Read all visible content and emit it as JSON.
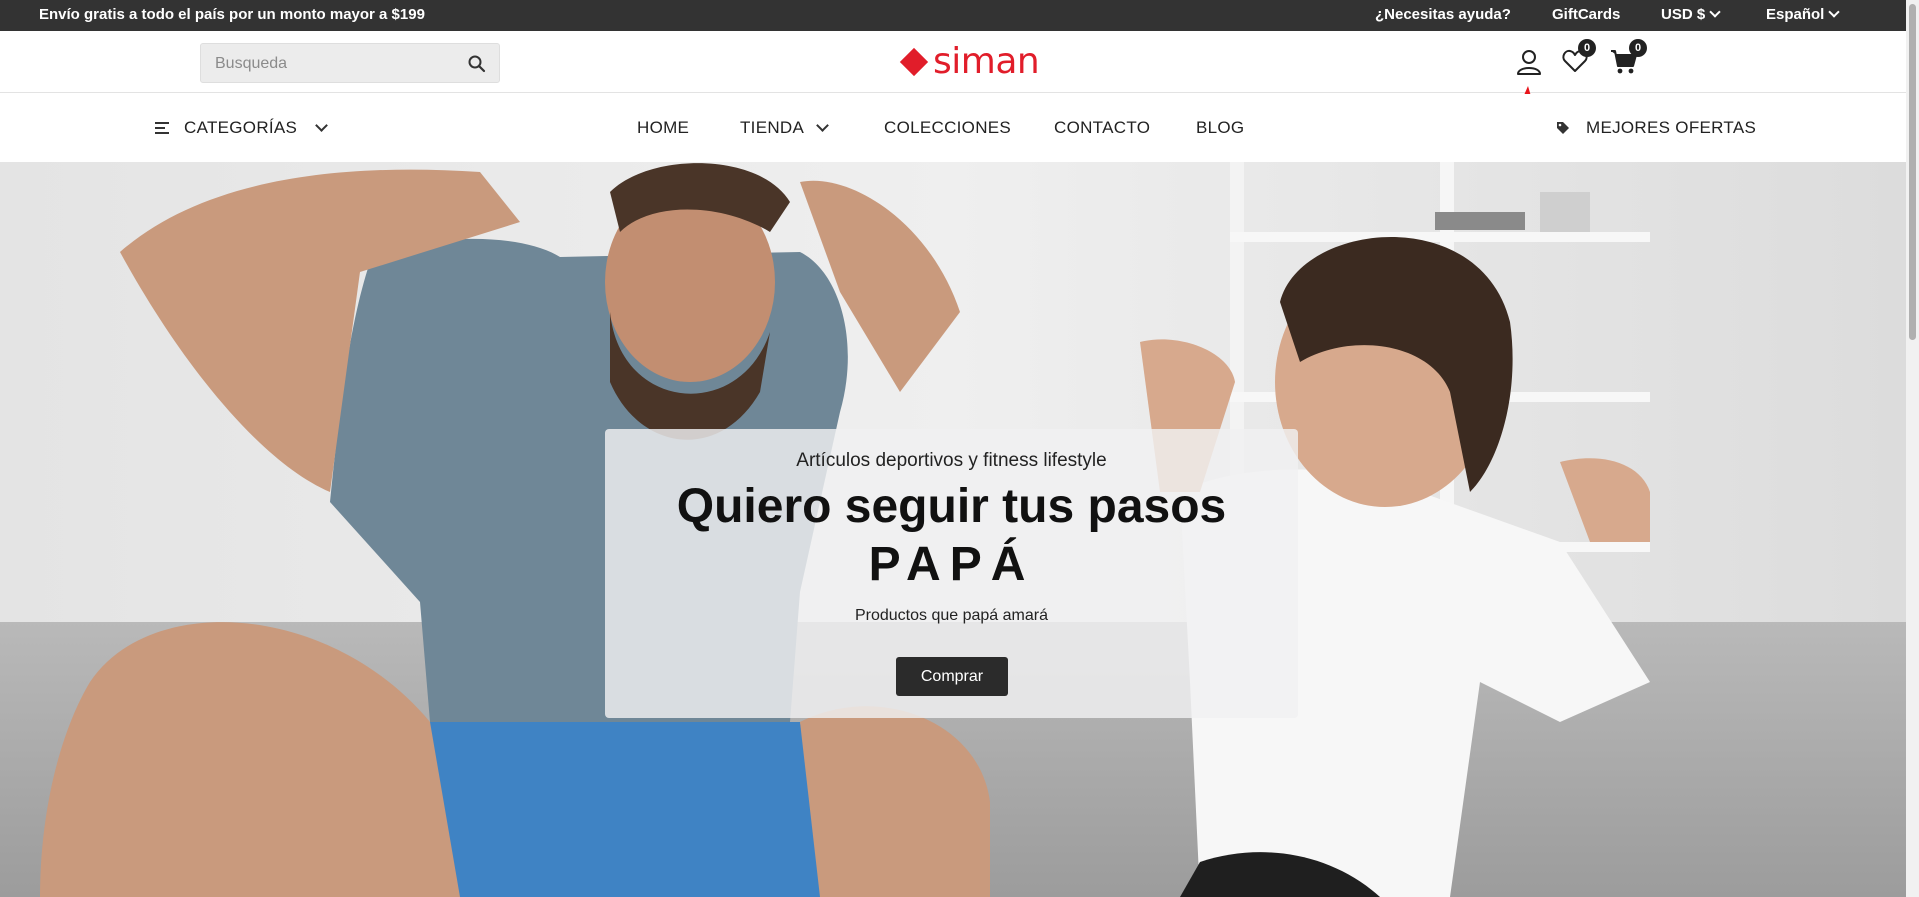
{
  "topbar": {
    "promo": "Envío gratis a todo el país por un monto mayor a $199",
    "help": "¿Necesitas ayuda?",
    "giftcards": "GiftCards",
    "currency": "USD $",
    "language": "Español"
  },
  "header": {
    "search_placeholder": "Busqueda",
    "logo_text": "siman",
    "wishlist_count": "0",
    "cart_count": "0"
  },
  "nav": {
    "categories": "CATEGORÍAS",
    "items": [
      {
        "label": "HOME"
      },
      {
        "label": "TIENDA"
      },
      {
        "label": "COLECCIONES"
      },
      {
        "label": "CONTACTO"
      },
      {
        "label": "BLOG"
      }
    ],
    "best_deals": "MEJORES OFERTAS"
  },
  "hero": {
    "kicker": "Artículos deportivos y fitness lifestyle",
    "headline": "Quiero seguir tus pasos",
    "headline2": "PAPÁ",
    "subtitle": "Productos que papá amará",
    "cta": "Comprar"
  },
  "colors": {
    "brand_red": "#e11d2a",
    "topbar_bg": "#333333",
    "cta_bg": "#2b2b2b",
    "annotation_arrow": "#e8141b"
  }
}
